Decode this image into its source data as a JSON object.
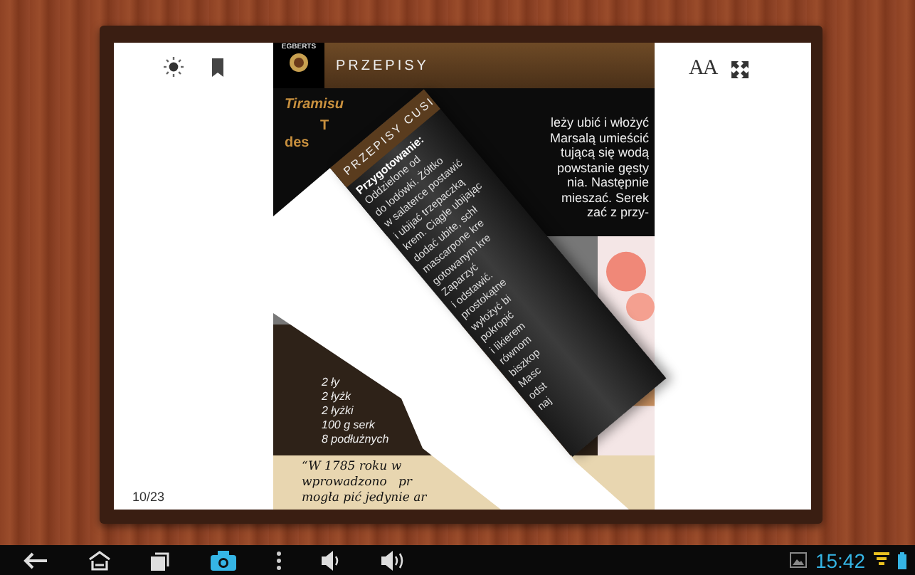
{
  "reader": {
    "page_indicator": "10/23",
    "font_size_label": "AA"
  },
  "page": {
    "logo": "EGBERTS",
    "header": "PRZEPISY",
    "recipe_title": "Tiramisu",
    "left_fragments": [
      "T",
      "des"
    ],
    "body_lines": [
      "leży ubić i włożyć",
      "Marsalą umieścić",
      "tującą się wodą",
      "powstanie gęsty",
      "nia. Następnie",
      "mieszać. Serek",
      "zać z przy-"
    ],
    "ingredients": [
      "2 ły",
      "2 łyżk",
      "2 łyżki",
      "100 g serk",
      "8 podłużnych"
    ],
    "quote_lines": [
      "“W 1785 roku w",
      "wprowadzono   pr",
      "mogła pić jedynie ar"
    ]
  },
  "turning_page": {
    "title": "PRZEPISY CUSI",
    "heading": "Przygotowanie:",
    "lines": [
      "Oddzielone od",
      "do lodówki. Żółtko",
      "w salaterce postawić",
      "i ubijać trzepaczką",
      "krem. Ciągle ubijając",
      "dodać ubite, schł",
      "mascarpone kre",
      "gotowanym kre",
      "Zaparzyć",
      "i odstawić.",
      "prostokątne",
      "wyłożyć bi",
      "pokropić",
      "i likierem",
      "równom",
      "biszkop",
      "Masc",
      "odst",
      "naj"
    ]
  },
  "navbar": {
    "time": "15:42"
  }
}
